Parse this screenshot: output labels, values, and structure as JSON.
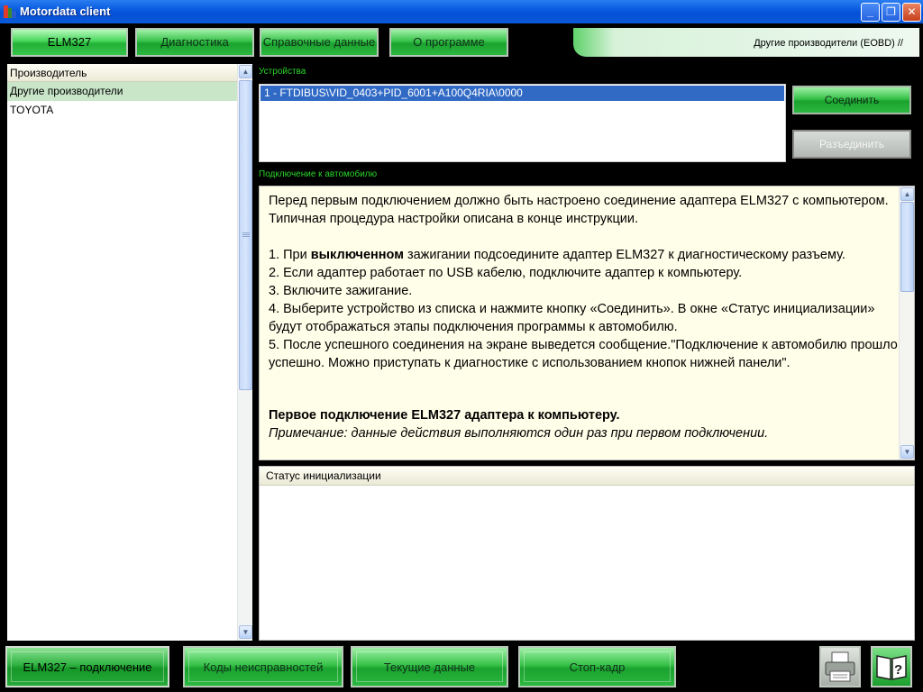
{
  "window": {
    "title": "Motordata client",
    "minimize": "_",
    "maximize": "❐",
    "close": "✕"
  },
  "tabs": [
    {
      "label": "ELM327"
    },
    {
      "label": "Диагностика"
    },
    {
      "label": "Справочные данные"
    },
    {
      "label": "О программе"
    }
  ],
  "info": {
    "text": "Другие производители  (EOBD) //"
  },
  "manufacturers": {
    "header": "Производитель",
    "items": [
      "Другие производители",
      "TOYOTA"
    ]
  },
  "devices": {
    "label": "Устройства",
    "items": [
      "1 - FTDIBUS\\VID_0403+PID_6001+A100Q4RIA\\0000"
    ],
    "connect": "Соединить",
    "disconnect": "Разъединить"
  },
  "connection": {
    "label": "Подключение к автомобилю",
    "intro": "Перед первым подключением должно быть настроено соединение адаптера ELM327 с компьютером. Типичная процедура настройки описана в конце инструкции.",
    "step1_a": "1. При ",
    "step1_bold": "выключенном",
    "step1_b": " зажигании подсоедините адаптер ELM327 к диагностическому разъему.",
    "step2": "2. Если адаптер работает по USB кабелю, подключите адаптер к компьютеру.",
    "step3": "3. Включите зажигание.",
    "step4": "4. Выберите устройство из списка и нажмите кнопку «Соединить». В окне «Статус инициализации» будут отображаться этапы подключения программы к автомобилю.",
    "step5": "5. После успешного соединения на экране выведется сообщение.\"Подключение к автомобилю прошло успешно. Можно приступать к диагностике с использованием кнопок нижней панели\".",
    "heading": "Первое подключение ELM327 адаптера к компьютеру.",
    "note": "Примечание: данные действия выполняются один раз при первом подключении."
  },
  "status": {
    "header": "Статус инициализации"
  },
  "bottom": [
    {
      "label": "ELM327 – подключение"
    },
    {
      "label": "Коды неисправностей"
    },
    {
      "label": "Текущие данные"
    },
    {
      "label": "Стоп-кадр"
    }
  ],
  "colors": {
    "accent_green": "#2cb840",
    "section_label": "#2bd62b",
    "selection": "#316ac5"
  }
}
